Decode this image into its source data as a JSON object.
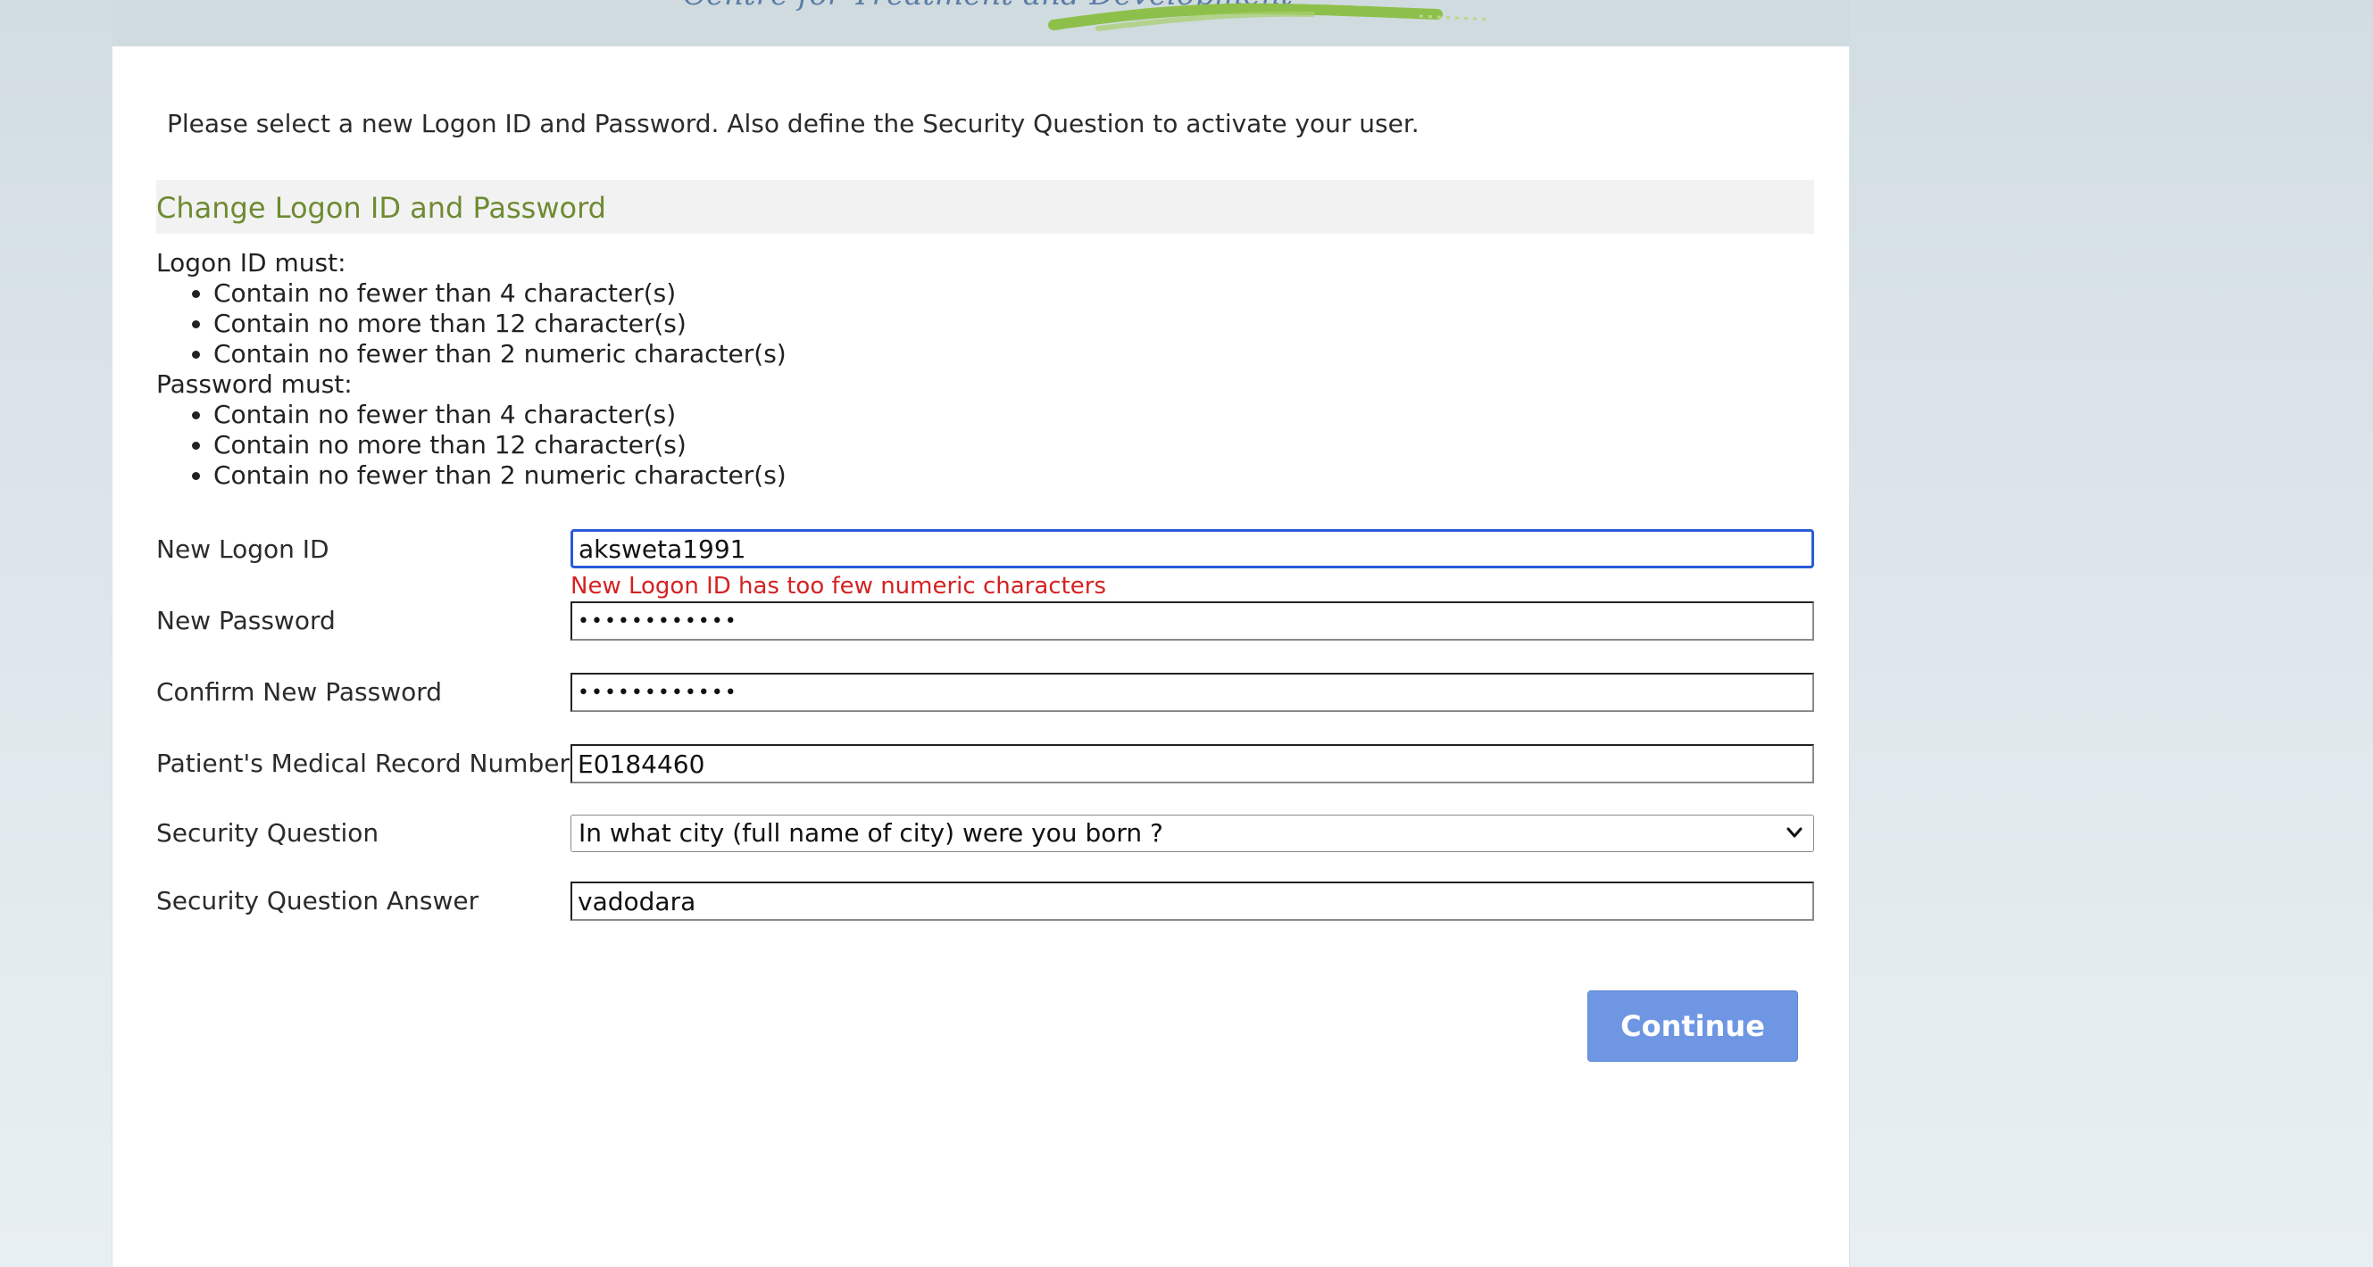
{
  "header": {
    "logo_text": "Centre for Treatment and Development"
  },
  "intro": "Please select a new Logon ID and Password. Also define the Security Question to activate your user.",
  "section_title": "Change Logon ID and Password",
  "rules": {
    "logon_heading": "Logon ID must:",
    "logon_items": [
      "Contain no fewer than 4 character(s)",
      "Contain no more than 12 character(s)",
      "Contain no fewer than 2 numeric character(s)"
    ],
    "password_heading": "Password must:",
    "password_items": [
      "Contain no fewer than 4 character(s)",
      "Contain no more than 12 character(s)",
      "Contain no fewer than 2 numeric character(s)"
    ]
  },
  "form": {
    "logon_label": "New Logon ID",
    "logon_value": "aksweta1991",
    "logon_error": "New Logon ID has too few numeric characters",
    "password_label": "New Password",
    "password_value": "••••••••••••",
    "confirm_label": "Confirm New Password",
    "confirm_value": "••••••••••••",
    "mrn_label": "Patient's Medical Record Number",
    "mrn_value": "E0184460",
    "question_label": "Security Question",
    "question_selected": "In what city (full name of city) were you born ?",
    "answer_label": "Security Question Answer",
    "answer_value": "vadodara"
  },
  "continue_label": "Continue",
  "colors": {
    "section_title": "#6e8b32",
    "error": "#d42222",
    "button": "#6f96e3",
    "focus_border": "#2a5bd7"
  }
}
